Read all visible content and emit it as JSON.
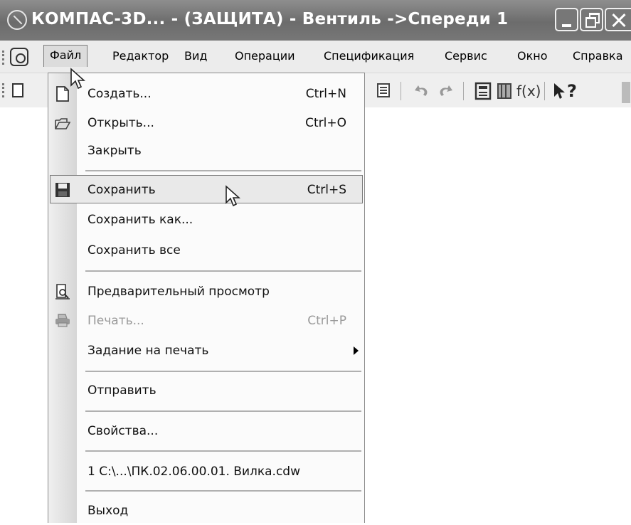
{
  "window": {
    "title": "КОМПАС-3D... - (ЗАЩИТА) - Вентиль ->Спереди 1"
  },
  "menubar": {
    "items": [
      "Файл",
      "Редактор",
      "Вид",
      "Операции",
      "Спецификация",
      "Сервис",
      "Окно",
      "Справка"
    ]
  },
  "file_menu": {
    "items": [
      {
        "label": "Создать...",
        "shortcut": "Ctrl+N",
        "icon": "new-document-icon"
      },
      {
        "label": "Открыть...",
        "shortcut": "Ctrl+O",
        "icon": "open-folder-icon"
      },
      {
        "label": "Закрыть",
        "shortcut": ""
      },
      {
        "label": "Сохранить",
        "shortcut": "Ctrl+S",
        "icon": "save-disk-icon",
        "highlighted": true
      },
      {
        "label": "Сохранить как...",
        "shortcut": ""
      },
      {
        "label": "Сохранить все",
        "shortcut": ""
      },
      {
        "label": "Предварительный просмотр",
        "shortcut": "",
        "icon": "print-preview-icon"
      },
      {
        "label": "Печать...",
        "shortcut": "Ctrl+P",
        "icon": "printer-icon",
        "disabled": true
      },
      {
        "label": "Задание на печать",
        "shortcut": "",
        "submenu": true
      },
      {
        "label": "Отправить",
        "shortcut": ""
      },
      {
        "label": "Свойства...",
        "shortcut": ""
      },
      {
        "label": "1 C:\\...\\ПК.02.06.00.01. Вилка.cdw",
        "shortcut": ""
      },
      {
        "label": "Выход",
        "shortcut": ""
      }
    ]
  },
  "toolbar": {
    "formula_label": "f(x)",
    "help_label": "?"
  }
}
